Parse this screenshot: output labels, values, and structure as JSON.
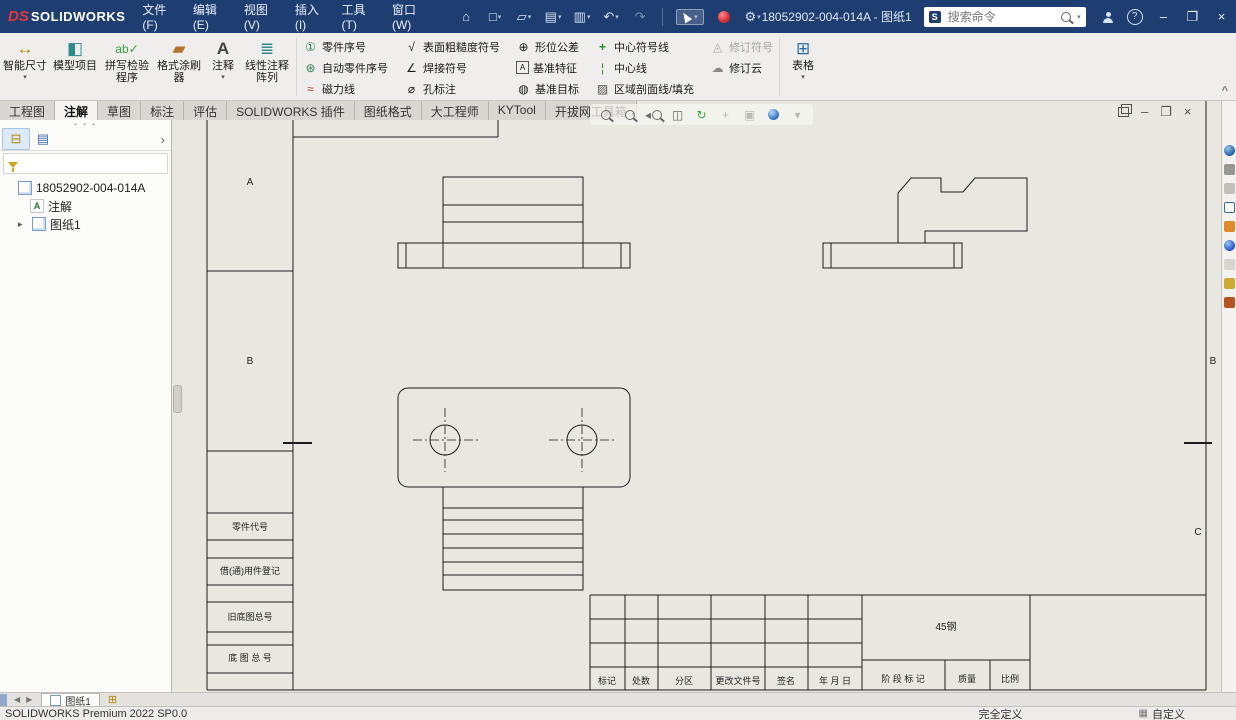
{
  "titlebar": {
    "brand_prefix": "DS",
    "brand": "SOLIDWORKS",
    "menus": [
      "文件(F)",
      "编辑(E)",
      "视图(V)",
      "插入(I)",
      "工具(T)",
      "窗口(W)"
    ],
    "document_title": "18052902-004-014A - 图纸1",
    "search_placeholder": "搜索命令"
  },
  "ribbon": {
    "large": [
      "智能尺寸",
      "模型项目",
      "拼写检验程序",
      "格式涂刷器",
      "注释",
      "线性注释阵列"
    ],
    "small": [
      "零件序号",
      "自动零件序号",
      "磁力线",
      "表面粗糙度符号",
      "焊接符号",
      "孔标注",
      "形位公差",
      "基准特征",
      "基准目标",
      "中心符号线",
      "中心线",
      "区域剖面线/填充",
      "修订符号",
      "修订云"
    ],
    "table": "表格"
  },
  "command_tabs": [
    "工程图",
    "注解",
    "草图",
    "标注",
    "评估",
    "SOLIDWORKS 插件",
    "图纸格式",
    "大工程师",
    "KYTool",
    "开拔网工具箱"
  ],
  "active_tab": "注解",
  "feature_tree": {
    "root": "18052902-004-014A",
    "children": [
      "注解",
      "图纸1"
    ]
  },
  "drawing": {
    "zones": {
      "left_a": "A",
      "left_b": "B",
      "right_b": "B",
      "right_c": "C"
    },
    "side_labels": [
      "零件代号",
      "借(通)用件登记",
      "旧底图总号",
      "底 图 总 号"
    ],
    "material": "45钢",
    "title_labels": [
      "标记",
      "处数",
      "分区",
      "更改文件号",
      "签名",
      "年 月 日",
      "阶 段 标 记",
      "质量",
      "比例"
    ]
  },
  "sheet_bar": {
    "tab": "图纸1"
  },
  "status_bar": {
    "product": "SOLIDWORKS Premium 2022 SP0.0",
    "state": "完全定义",
    "customize": "自定义"
  },
  "colors": {
    "titlebar": "#1e3e71",
    "canvas": "#e8e8e0",
    "accent_red": "#d1272e"
  },
  "icons": {
    "hud": [
      "zoom-fit",
      "zoom-area",
      "previous-view",
      "section-view",
      "view-orientation",
      "pan",
      "hide-show-items",
      "edit-appearance",
      "view-settings"
    ],
    "task_pane": [
      "solidworks-resources",
      "design-library",
      "file-explorer",
      "view-palette",
      "appearances-scenes",
      "custom-properties",
      "solidworks-forum",
      "user-library",
      "subscription-services"
    ]
  }
}
